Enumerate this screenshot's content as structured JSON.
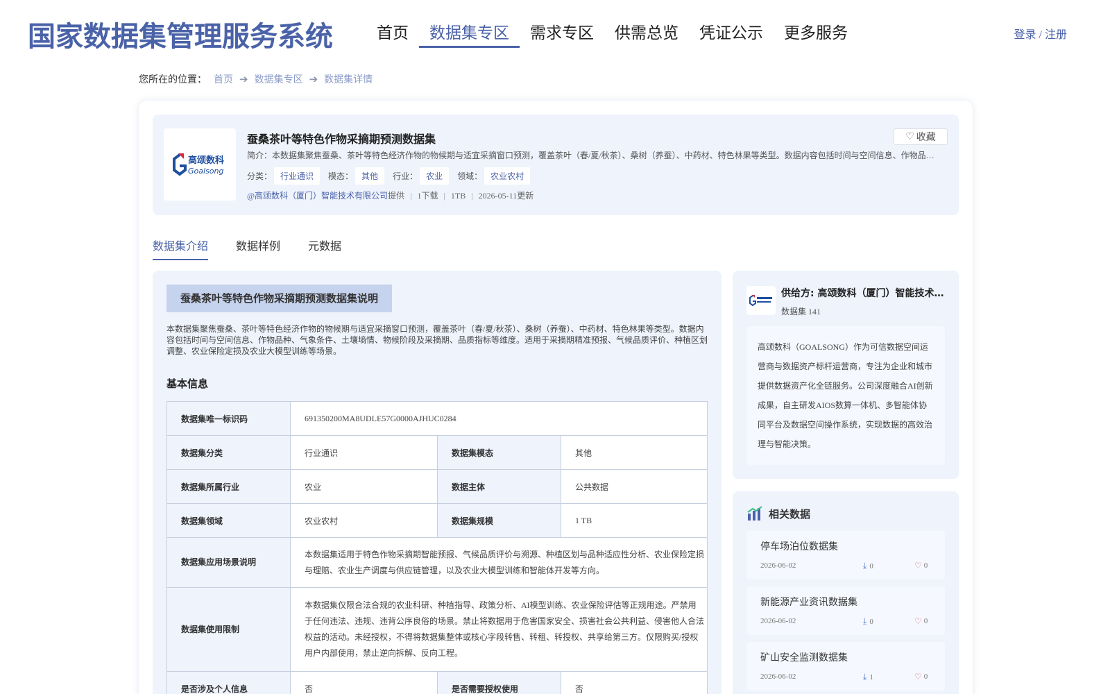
{
  "header": {
    "site_title": "国家数据集管理服务系统",
    "nav": [
      {
        "label": "首页",
        "active": false
      },
      {
        "label": "数据集专区",
        "active": true
      },
      {
        "label": "需求专区",
        "active": false
      },
      {
        "label": "供需总览",
        "active": false
      },
      {
        "label": "凭证公示",
        "active": false
      },
      {
        "label": "更多服务",
        "active": false
      }
    ],
    "login_label": "登录 / 注册"
  },
  "breadcrumb": {
    "label": "您所在的位置：",
    "items": [
      "首页",
      "数据集专区",
      "数据集详情"
    ]
  },
  "dataset": {
    "logo_text_cn": "高颂数科",
    "logo_text_en": "Goalsong",
    "title": "蚕桑茶叶等特色作物采摘期预测数据集",
    "favorite_label": "收藏",
    "summary": "简介：本数据集聚焦蚕桑、茶叶等特色经济作物的物候期与适宜采摘窗口预测，覆盖茶叶（春/夏/秋茶）、桑树（养蚕）、中药材、特色林果等类型。数据内容包括时间与空间信息、作物品种、气象条件、土壤墒情、物候阶段及采摘期、品质指标等维度。",
    "tags": [
      {
        "label": "分类：",
        "value": "行业通识"
      },
      {
        "label": "模态：",
        "value": "其他"
      },
      {
        "label": "行业：",
        "value": "农业"
      },
      {
        "label": "领域：",
        "value": "农业农村"
      }
    ],
    "provider_link": "@高颂数科（厦门）智能技术有限公司",
    "provider_suffix": "提供",
    "downloads": "1下载",
    "size": "1TB",
    "updated": "2026-05-11更新"
  },
  "tabs": [
    "数据集介绍",
    "数据样例",
    "元数据"
  ],
  "intro": {
    "section_title": "蚕桑茶叶等特色作物采摘期预测数据集说明",
    "text": "本数据集聚焦蚕桑、茶叶等特色经济作物的物候期与适宜采摘窗口预测，覆盖茶叶（春/夏/秋茶）、桑树（养蚕）、中药材、特色林果等类型。数据内容包括时间与空间信息、作物品种、气象条件、土壤墒情、物候阶段及采摘期、品质指标等维度。适用于采摘期精准预报、气候品质评价、种植区划调整、农业保险定损及农业大模型训练等场景。",
    "basic_title": "基本信息"
  },
  "basic_info": {
    "id_key": "数据集唯一标识码",
    "id_value": "691350200MA8UDLE57G0000AJHUC0284",
    "category_key": "数据集分类",
    "category_value": "行业通识",
    "modality_key": "数据集模态",
    "modality_value": "其他",
    "industry_key": "数据集所属行业",
    "industry_value": "农业",
    "subject_key": "数据主体",
    "subject_value": "公共数据",
    "domain_key": "数据集领域",
    "domain_value": "农业农村",
    "scale_key": "数据集规模",
    "scale_value": "1 TB",
    "scenario_key": "数据集应用场景说明",
    "scenario_value": "本数据集适用于特色作物采摘期智能预报、气候品质评价与溯源、种植区划与品种适应性分析、农业保险定损与理赔、农业生产调度与供应链管理，以及农业大模型训练和智能体开发等方向。",
    "limit_key": "数据集使用限制",
    "limit_value": "本数据集仅限合法合规的农业科研、种植指导、政策分析、AI模型训练、农业保险评估等正规用途。严禁用于任何违法、违规、违背公序良俗的场景。禁止将数据用于危害国家安全、损害社会公共利益、侵害他人合法权益的活动。未经授权，不得将数据集整体或核心字段转售、转租、转授权、共享给第三方。仅限购买/授权用户内部使用，禁止逆向拆解、反向工程。",
    "personal_key": "是否涉及个人信息",
    "personal_value": "否",
    "auth_key": "是否需要授权使用",
    "auth_value": "否"
  },
  "supplier": {
    "name": "供给方: 高颂数科（厦门）智能技术有限公司",
    "dataset_count": "数据集 141",
    "description": "高颂数科（GOALSONG）作为可信数据空间运营商与数据资产标杆运营商，专注为企业和城市提供数据资产化全链服务。公司深度融合AI创新成果，自主研发AIOS数算一体机、多智能体协同平台及数据空间操作系统，实现数据的高效治理与智能决策。"
  },
  "related": {
    "title": "相关数据",
    "items": [
      {
        "name": "停车场泊位数据集",
        "date": "2026-06-02",
        "downloads": "0",
        "likes": "0"
      },
      {
        "name": "新能源产业资讯数据集",
        "date": "2026-06-02",
        "downloads": "0",
        "likes": "0"
      },
      {
        "name": "矿山安全监测数据集",
        "date": "2026-06-02",
        "downloads": "1",
        "likes": "0"
      }
    ]
  },
  "colors": {
    "brand": "#4a62a8",
    "panel_bg": "#eef3fc",
    "like": "#e05c6a",
    "logo_red": "#d8283a",
    "logo_blue": "#1f4fa0"
  },
  "icons": {
    "favorite": "heart-outline-icon",
    "download": "download-icon",
    "like": "heart-outline-icon",
    "related": "bar-chart-icon",
    "breadcrumb_separator": "arrow-right-icon"
  }
}
